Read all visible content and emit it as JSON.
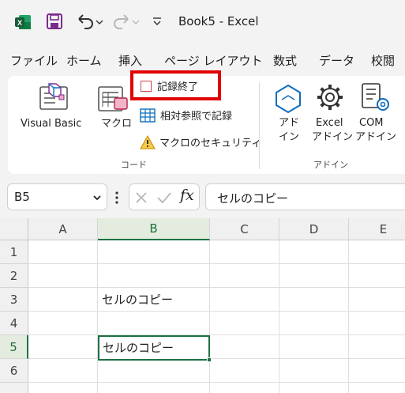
{
  "titlebar": {
    "doc_title": "Book5  -  Excel",
    "icons": [
      "excel-logo-icon",
      "save-icon",
      "undo-icon",
      "redo-icon",
      "customize-qat-icon"
    ]
  },
  "tabs": [
    "ファイル",
    "ホーム",
    "挿入",
    "ページ レイアウト",
    "数式",
    "データ",
    "校閲"
  ],
  "ribbon": {
    "code_group": {
      "label": "コード",
      "visual_basic": "Visual Basic",
      "macro": "マクロ",
      "stop_recording": "記録終了",
      "relative_reference": "相対参照で記録",
      "macro_security": "マクロのセキュリティ"
    },
    "addins_group": {
      "label": "アドイン",
      "addins_line1": "アド",
      "addins_line2": "イン",
      "excel_addins_line1": "Excel",
      "excel_addins_line2": "アドイン",
      "com_addins_line1": "COM",
      "com_addins_line2": "アドイン"
    }
  },
  "formula_bar": {
    "name_box": "B5",
    "fx_label": "fx",
    "formula": "セルのコピー"
  },
  "grid": {
    "columns": [
      "A",
      "B",
      "C",
      "D",
      "E"
    ],
    "selected_column": "B",
    "rows": [
      "1",
      "2",
      "3",
      "4",
      "5",
      "6"
    ],
    "selected_row": "5",
    "cells": {
      "B3": "セルのコピー",
      "B5": "セルのコピー"
    }
  },
  "colors": {
    "accent": "#1e7145",
    "highlight": "#e00000"
  }
}
